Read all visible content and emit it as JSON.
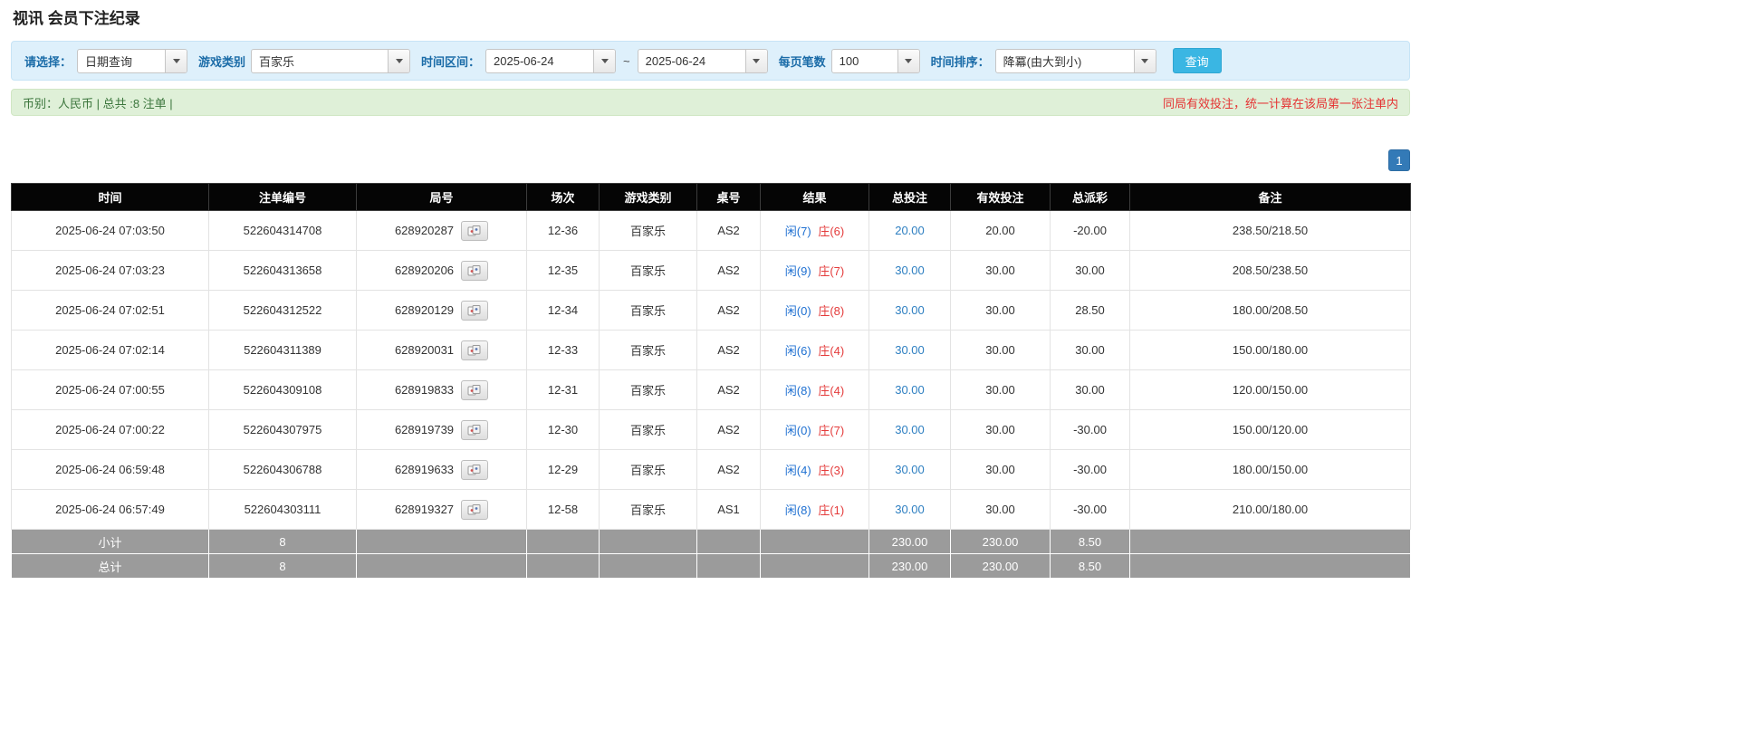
{
  "colors": {
    "accent_blue": "#337ab7",
    "link_blue": "#2e7fc1",
    "negative_red": "#e43b3b",
    "player_blue": "#1d6fd1",
    "banker_red": "#e43b3b",
    "success_green": "#3c763d",
    "notice_red": "#e53333",
    "table_header_black": "#050505",
    "footer_gray": "#9b9b9b",
    "filter_bar_bg": "#def0fb",
    "summary_bar_bg": "#dff0d8",
    "search_button_bg": "#3ab6e3"
  },
  "page": {
    "title": "视讯 会员下注纪录"
  },
  "filters": {
    "select_label": "请选择：",
    "select_value": "日期查询",
    "game_type_label": "游戏类别",
    "game_type_value": "百家乐",
    "time_range_label": "时间区间：",
    "date_from": "2025-06-24",
    "range_separator": "~",
    "date_to": "2025-06-24",
    "page_size_label": "每页笔数",
    "page_size_value": "100",
    "sort_label": "时间排序：",
    "sort_value": "降冪(由大到小)",
    "search_button_label": "查询",
    "dropdown_icon": "caret-down-icon"
  },
  "summary": {
    "currency_info": "币别：人民币 | 总共 :8 注单 |",
    "notice": "同局有效投注，统一计算在该局第一张注单内"
  },
  "pagination": {
    "current_page": "1"
  },
  "table": {
    "headers": [
      "时间",
      "注单编号",
      "局号",
      "场次",
      "游戏类别",
      "桌号",
      "结果",
      "总投注",
      "有效投注",
      "总派彩",
      "备注"
    ],
    "rows": [
      {
        "time": "2025-06-24 07:03:50",
        "bet_id": "522604314708",
        "round_id": "628920287",
        "session": "12-36",
        "game": "百家乐",
        "table": "AS2",
        "result_player": "闲(7)",
        "result_banker": "庄(6)",
        "total_bet": "20.00",
        "valid_bet": "20.00",
        "payout": "-20.00",
        "note": "238.50/218.50"
      },
      {
        "time": "2025-06-24 07:03:23",
        "bet_id": "522604313658",
        "round_id": "628920206",
        "session": "12-35",
        "game": "百家乐",
        "table": "AS2",
        "result_player": "闲(9)",
        "result_banker": "庄(7)",
        "total_bet": "30.00",
        "valid_bet": "30.00",
        "payout": "30.00",
        "note": "208.50/238.50"
      },
      {
        "time": "2025-06-24 07:02:51",
        "bet_id": "522604312522",
        "round_id": "628920129",
        "session": "12-34",
        "game": "百家乐",
        "table": "AS2",
        "result_player": "闲(0)",
        "result_banker": "庄(8)",
        "total_bet": "30.00",
        "valid_bet": "30.00",
        "payout": "28.50",
        "note": "180.00/208.50"
      },
      {
        "time": "2025-06-24 07:02:14",
        "bet_id": "522604311389",
        "round_id": "628920031",
        "session": "12-33",
        "game": "百家乐",
        "table": "AS2",
        "result_player": "闲(6)",
        "result_banker": "庄(4)",
        "total_bet": "30.00",
        "valid_bet": "30.00",
        "payout": "30.00",
        "note": "150.00/180.00"
      },
      {
        "time": "2025-06-24 07:00:55",
        "bet_id": "522604309108",
        "round_id": "628919833",
        "session": "12-31",
        "game": "百家乐",
        "table": "AS2",
        "result_player": "闲(8)",
        "result_banker": "庄(4)",
        "total_bet": "30.00",
        "valid_bet": "30.00",
        "payout": "30.00",
        "note": "120.00/150.00"
      },
      {
        "time": "2025-06-24 07:00:22",
        "bet_id": "522604307975",
        "round_id": "628919739",
        "session": "12-30",
        "game": "百家乐",
        "table": "AS2",
        "result_player": "闲(0)",
        "result_banker": "庄(7)",
        "total_bet": "30.00",
        "valid_bet": "30.00",
        "payout": "-30.00",
        "note": "150.00/120.00"
      },
      {
        "time": "2025-06-24 06:59:48",
        "bet_id": "522604306788",
        "round_id": "628919633",
        "session": "12-29",
        "game": "百家乐",
        "table": "AS2",
        "result_player": "闲(4)",
        "result_banker": "庄(3)",
        "total_bet": "30.00",
        "valid_bet": "30.00",
        "payout": "-30.00",
        "note": "180.00/150.00"
      },
      {
        "time": "2025-06-24 06:57:49",
        "bet_id": "522604303111",
        "round_id": "628919327",
        "session": "12-58",
        "game": "百家乐",
        "table": "AS1",
        "result_player": "闲(8)",
        "result_banker": "庄(1)",
        "total_bet": "30.00",
        "valid_bet": "30.00",
        "payout": "-30.00",
        "note": "210.00/180.00"
      }
    ],
    "subtotal": {
      "label": "小计",
      "count": "8",
      "total_bet": "230.00",
      "valid_bet": "230.00",
      "payout": "8.50"
    },
    "total": {
      "label": "总计",
      "count": "8",
      "total_bet": "230.00",
      "valid_bet": "230.00",
      "payout": "8.50"
    }
  }
}
